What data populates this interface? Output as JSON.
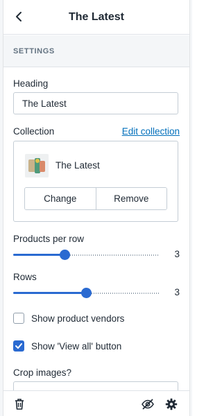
{
  "header": {
    "title": "The Latest"
  },
  "section": {
    "title": "SETTINGS"
  },
  "heading_field": {
    "label": "Heading",
    "value": "The Latest"
  },
  "collection": {
    "label": "Collection",
    "edit_link": "Edit collection",
    "name": "The Latest",
    "change_label": "Change",
    "remove_label": "Remove"
  },
  "products_per_row": {
    "label": "Products per row",
    "value": "3",
    "fraction": 0.35
  },
  "rows": {
    "label": "Rows",
    "value": "3",
    "fraction": 0.5
  },
  "show_vendors": {
    "label": "Show product vendors",
    "checked": false
  },
  "show_view_all": {
    "label": "Show 'View all' button",
    "checked": true
  },
  "crop_images": {
    "label": "Crop images?"
  },
  "colors": {
    "accent": "#2a6ad1",
    "link": "#006fbb"
  },
  "icons": {
    "back": "chevron-left-icon",
    "delete": "trash-icon",
    "hide": "eye-off-icon",
    "settings": "gear-icon"
  }
}
